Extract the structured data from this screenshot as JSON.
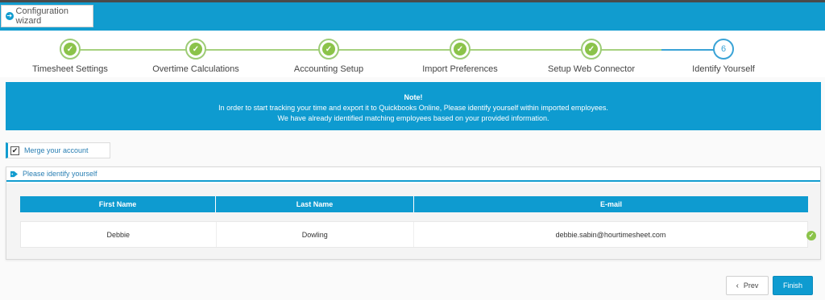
{
  "header": {
    "wizard_label": "Configuration wizard",
    "accent_color": "#119ccf"
  },
  "steps": [
    {
      "label": "Timesheet Settings",
      "status": "done"
    },
    {
      "label": "Overtime Calculations",
      "status": "done"
    },
    {
      "label": "Accounting Setup",
      "status": "done"
    },
    {
      "label": "Import Preferences",
      "status": "done"
    },
    {
      "label": "Setup Web Connector",
      "status": "done"
    },
    {
      "label": "Identify Yourself",
      "status": "current",
      "number": "6"
    }
  ],
  "note": {
    "title": "Note!",
    "line1": "In order to start tracking your time and export it to Quickbooks Online, Please identify yourself within imported employees.",
    "line2": "We have already identified matching employees based on your provided information."
  },
  "merge": {
    "label": "Merge your account",
    "checked": true
  },
  "panel": {
    "title": "Please identify yourself"
  },
  "table": {
    "headers": [
      "First Name",
      "Last Name",
      "E-mail"
    ],
    "rows": [
      {
        "first_name": "Debbie",
        "last_name": "Dowling",
        "email": "debbie.sabin@hourtimesheet.com"
      }
    ]
  },
  "buttons": {
    "prev": "Prev",
    "finish": "Finish"
  },
  "colors": {
    "done_green": "#8bc34a",
    "current_blue": "#3aa3d6",
    "note_bg": "#0e9bd0"
  }
}
